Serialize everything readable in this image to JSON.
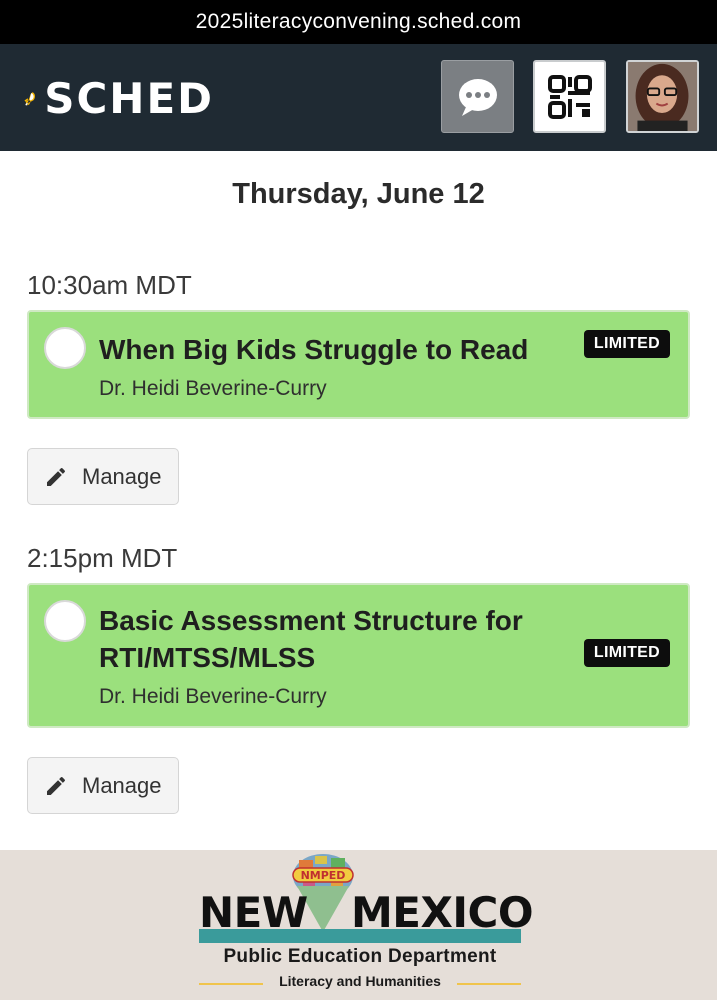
{
  "browser": {
    "url": "2025literacyconvening.sched.com"
  },
  "header": {
    "brand": "SCHED",
    "icons": {
      "chat": "chat-bubble-icon",
      "qr": "qr-code-icon",
      "avatar": "user-avatar"
    },
    "colors": {
      "bar": "#1f2a33",
      "chat_button": "#7b7f83"
    }
  },
  "schedule": {
    "day": "Thursday, June 12",
    "slots": [
      {
        "time": "10:30am MDT",
        "session": {
          "title": "When Big Kids Struggle to Read",
          "speaker": "Dr. Heidi Beverine-Curry",
          "badge": "LIMITED"
        },
        "manage_label": "Manage"
      },
      {
        "time": "2:15pm MDT",
        "session": {
          "title_line1": "Basic Assessment Structure for",
          "title_line2": "RTI/MTSS/MLSS",
          "speaker": "Dr. Heidi Beverine-Curry",
          "badge": "LIMITED"
        },
        "manage_label": "Manage"
      }
    ],
    "colors": {
      "session_bg": "#9be07d",
      "badge_bg": "#0d0d0d"
    }
  },
  "footer": {
    "logo_left": "NEW",
    "logo_right": "MEXICO",
    "logo_badge": "NMPED",
    "department": "Public Education Department",
    "division": "Literacy and Humanities",
    "colors": {
      "band": "#3a9b9b",
      "accent": "#f0c44c"
    }
  }
}
